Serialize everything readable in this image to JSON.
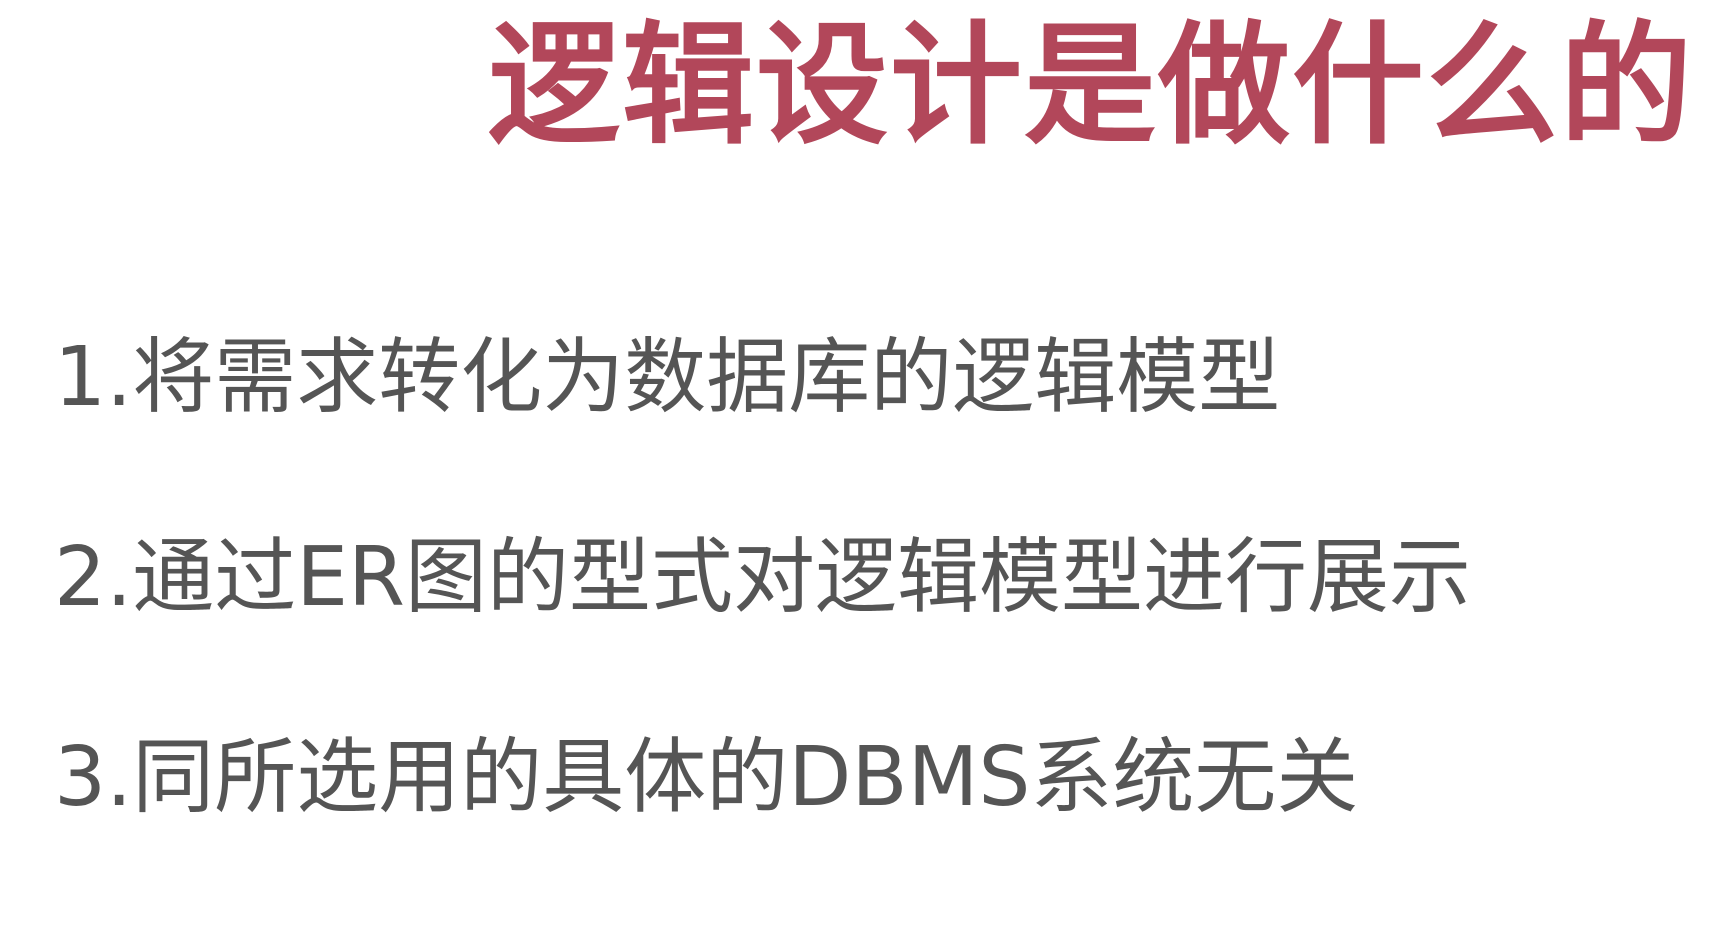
{
  "title": "逻辑设计是做什么的",
  "points": [
    "1.将需求转化为数据库的逻辑模型",
    "2.通过ER图的型式对逻辑模型进行展示",
    "3.同所选用的具体的DBMS系统无关"
  ],
  "colors": {
    "title": "#b2475a",
    "text": "#555555",
    "background": "#ffffff"
  }
}
